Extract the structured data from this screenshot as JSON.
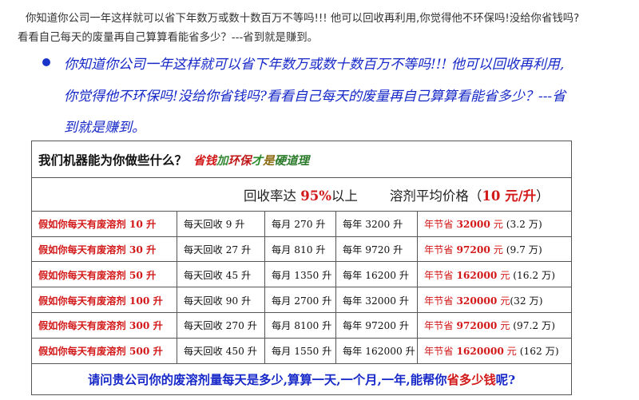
{
  "intro": {
    "line1": "你知道你公司一年这样就可以省下年数万或数十数百万不等吗!!! 他可以回收再利用,你觉得他不环保吗!没给你省钱吗?",
    "line2": "看看自己每天的废量再自己算算看能省多少？---省到就是赚到。"
  },
  "bullet": {
    "text": "你知道你公司一年这样就可以省下年数万或数十数百万不等吗!!!  他可以回收再利用,你觉得他不环保吗!没给你省钱吗?看看自己每天的废量再自己算算看能省多少？---省到就是赚到。",
    "color": "#1628c8"
  },
  "table": {
    "heading": "我们机器能为你做些什么？",
    "badge": {
      "p1": "省钱",
      "p2": "加",
      "p3": "环保",
      "p4": "才",
      "p5": "是",
      "p6": "硬道理"
    },
    "rate": {
      "pre": "回收率达 ",
      "pct": "95%",
      "post": "以上",
      "price_pre": "溶剂平均价格（",
      "price": "10 元/升",
      "price_post": "）"
    },
    "rows": [
      {
        "label": "假如你每天有废溶剂 10 升",
        "daily": "每天回收 9 升",
        "monthly": "每月 270 升",
        "yearly": "每年 3200 升",
        "save_label": "年节省 ",
        "save_amount": "32000",
        "save_unit": " 元 ",
        "save_wan": "(3.2 万)"
      },
      {
        "label": "假如你每天有废溶剂 30 升",
        "daily": "每天回收 27 升",
        "monthly": "每月 810 升",
        "yearly": "每年 9720 升",
        "save_label": "年节省 ",
        "save_amount": "97200",
        "save_unit": " 元 ",
        "save_wan": "(9.7 万)"
      },
      {
        "label": "假如你每天有废溶剂 50 升",
        "daily": "每天回收 45 升",
        "monthly": "每月 1350 升",
        "yearly": "每年 16200 升",
        "save_label": "年节省 ",
        "save_amount": "162000",
        "save_unit": " 元 ",
        "save_wan": "(16.2 万)"
      },
      {
        "label": "假如你每天有废溶剂 100 升",
        "daily": "每天回收 90 升",
        "monthly": "每月 2700 升",
        "yearly": "每年 32000 升",
        "save_label": "年节省 ",
        "save_amount": "320000",
        "save_unit": " 元",
        "save_wan": "(32 万)"
      },
      {
        "label": "假如你每天有废溶剂 300 升",
        "daily": "每天回收 270 升",
        "monthly": "每月 8100 升",
        "yearly": "每年 97200 升",
        "save_label": "年节省 ",
        "save_amount": "972000",
        "save_unit": " 元 ",
        "save_wan": "(97.2 万)"
      },
      {
        "label": "假如你每天有废溶剂 500 升",
        "daily": "每天回收 450 升",
        "monthly": "每月 1550 升",
        "yearly": "每年 162000 升",
        "save_label": "年节省 ",
        "save_amount": "1620000",
        "save_unit": " 元 ",
        "save_wan": "(162 万)"
      }
    ],
    "footer": {
      "pre": "请问贵公司你的废溶剂量每天是多少,算算一天,一个月,一年,能帮你",
      "highlight": "省多少钱",
      "post": "呢?"
    }
  }
}
